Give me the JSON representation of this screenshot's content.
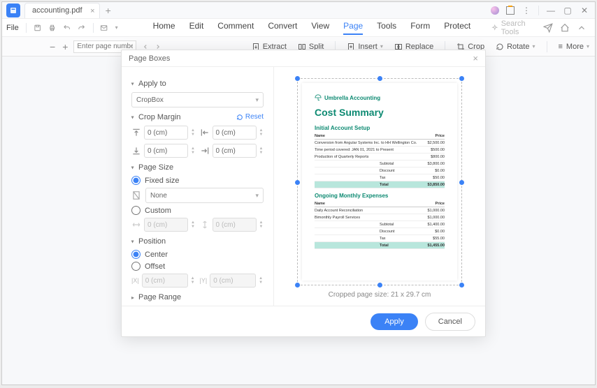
{
  "titlebar": {
    "tab_name": "accounting.pdf"
  },
  "menustrip": {
    "file": "File",
    "items": [
      "Home",
      "Edit",
      "Comment",
      "Convert",
      "View",
      "Page",
      "Tools",
      "Form",
      "Protect"
    ],
    "active_index": 5,
    "search_placeholder": "Search Tools"
  },
  "toolbar": {
    "zoom_minus": "−",
    "zoom_plus": "+",
    "pagenum_placeholder": "Enter page number",
    "extract": "Extract",
    "split": "Split",
    "insert": "Insert",
    "replace": "Replace",
    "crop": "Crop",
    "rotate": "Rotate",
    "more": "More"
  },
  "dialog": {
    "title": "Page Boxes",
    "apply_to_label": "Apply to",
    "apply_to_value": "CropBox",
    "crop_margin_label": "Crop Margin",
    "reset": "Reset",
    "margins": {
      "top": "0 (cm)",
      "left": "0 (cm)",
      "bottom": "0 (cm)",
      "right": "0 (cm)"
    },
    "page_size_label": "Page Size",
    "fixed_size": "Fixed size",
    "none_value": "None",
    "custom": "Custom",
    "custom_w": "0 (cm)",
    "custom_h": "0 (cm)",
    "position_label": "Position",
    "center": "Center",
    "offset": "Offset",
    "offset_x": "0 (cm)",
    "offset_y": "0 (cm)",
    "page_range_label": "Page Range",
    "crop_info": "Cropped page size: 21 x 29.7 cm",
    "apply": "Apply",
    "cancel": "Cancel"
  },
  "document": {
    "company": "Umbrella Accounting",
    "title": "Cost Summary",
    "section1": {
      "heading": "Initial Account Setup",
      "name_col": "Name",
      "price_col": "Price",
      "rows": [
        {
          "name": "Conversion from Angular Systems Inc. to HH Wellington Co.",
          "price": "$2,500.00"
        },
        {
          "name": "Time period covered: JAN 01, 2021 to Present",
          "price": "$500.00"
        },
        {
          "name": "Production of Quarterly Reports",
          "price": "$800.00"
        }
      ],
      "subtotals": [
        {
          "label": "Subtotal",
          "value": "$3,800.00"
        },
        {
          "label": "Discount",
          "value": "$0.00"
        },
        {
          "label": "Tax",
          "value": "$50.00"
        }
      ],
      "total": {
        "label": "Total",
        "value": "$3,850.00"
      }
    },
    "section2": {
      "heading": "Ongoing Monthly Expenses",
      "name_col": "Name",
      "price_col": "Price",
      "rows": [
        {
          "name": "Daily Account Reconciliation",
          "price": "$1,000.00"
        },
        {
          "name": "Bimonthly Payroll Services",
          "price": "$1,000.00"
        }
      ],
      "subtotals": [
        {
          "label": "Subtotal",
          "value": "$1,400.00"
        },
        {
          "label": "Discount",
          "value": "$0.00"
        },
        {
          "label": "Tax",
          "value": "$55.00"
        }
      ],
      "total": {
        "label": "Total",
        "value": "$1,455.00"
      }
    }
  }
}
